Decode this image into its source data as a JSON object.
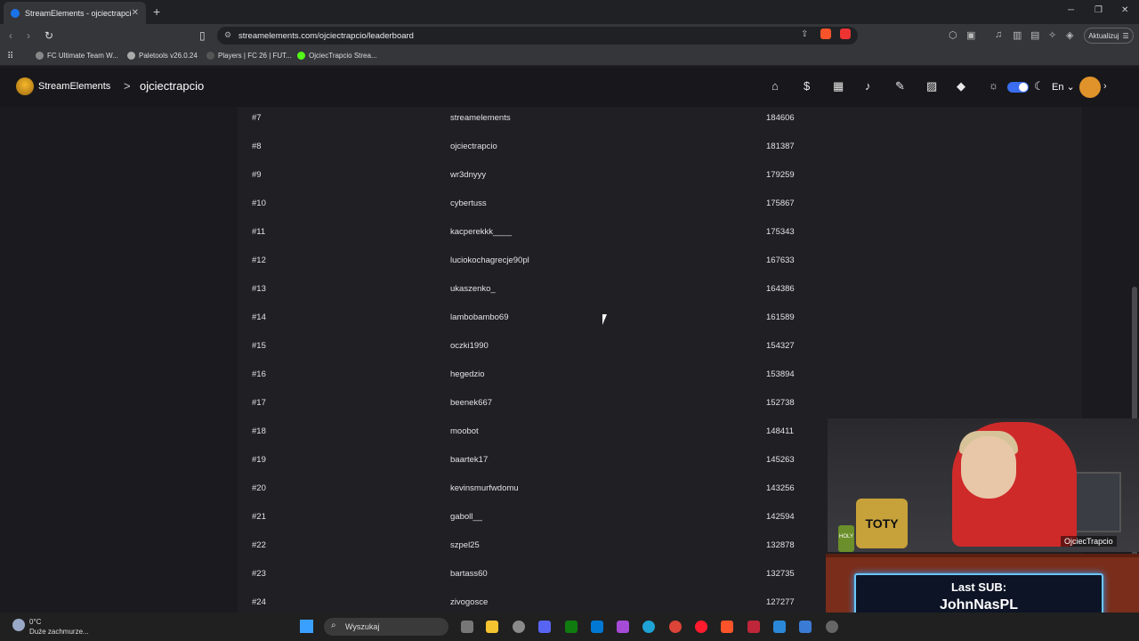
{
  "browser": {
    "tab_title": "StreamElements - ojciectrapcio",
    "url": "streamelements.com/ojciectrapcio/leaderboard",
    "update_label": "Aktualizuj",
    "bookmarks": [
      {
        "label": "FC Ultimate Team W...",
        "color": "#888888"
      },
      {
        "label": "Paletools v26.0.24",
        "color": "#aaaaaa"
      },
      {
        "label": "Players | FC 26 | FUT...",
        "color": "#555555"
      },
      {
        "label": "OjciecTrapcio Strea...",
        "color": "#53fc18"
      }
    ]
  },
  "header": {
    "brand": "StreamElements",
    "separator": ">",
    "channel": "ojciectrapcio",
    "language": "En",
    "nav_icons": [
      "home-icon",
      "dollar-icon",
      "store-icon",
      "music-icon",
      "tools-icon",
      "stats-icon",
      "gem-icon"
    ]
  },
  "leaderboard": {
    "rows": [
      {
        "rank": "#7",
        "name": "streamelements",
        "points": "184606"
      },
      {
        "rank": "#8",
        "name": "ojciectrapcio",
        "points": "181387"
      },
      {
        "rank": "#9",
        "name": "wr3dnyyy",
        "points": "179259"
      },
      {
        "rank": "#10",
        "name": "cybertuss",
        "points": "175867"
      },
      {
        "rank": "#11",
        "name": "kacperekkk____",
        "points": "175343"
      },
      {
        "rank": "#12",
        "name": "luciokochagrecje90pl",
        "points": "167633"
      },
      {
        "rank": "#13",
        "name": "ukaszenko_",
        "points": "164386"
      },
      {
        "rank": "#14",
        "name": "lambobambo69",
        "points": "161589"
      },
      {
        "rank": "#15",
        "name": "oczki1990",
        "points": "154327"
      },
      {
        "rank": "#16",
        "name": "hegedzio",
        "points": "153894"
      },
      {
        "rank": "#17",
        "name": "beenek667",
        "points": "152738"
      },
      {
        "rank": "#18",
        "name": "moobot",
        "points": "148411"
      },
      {
        "rank": "#19",
        "name": "baartek17",
        "points": "145263"
      },
      {
        "rank": "#20",
        "name": "kevinsmurfwdomu",
        "points": "143256"
      },
      {
        "rank": "#21",
        "name": "gaboll__",
        "points": "142594"
      },
      {
        "rank": "#22",
        "name": "szpel25",
        "points": "132878"
      },
      {
        "rank": "#23",
        "name": "bartass60",
        "points": "132735"
      },
      {
        "rank": "#24",
        "name": "zivogosce",
        "points": "127277"
      }
    ]
  },
  "overlay": {
    "badge": "TOTY",
    "can": "HOLY",
    "cam_name": "OjciecTrapcio",
    "last_sub_label": "Last SUB:",
    "last_sub_name": "JohnNasPL"
  },
  "taskbar": {
    "temperature": "0°C",
    "weather": "Duże zachmurze...",
    "search_placeholder": "Wyszukaj"
  },
  "colors": {
    "page_bg": "#1b1b1f",
    "board_bg": "#1f1f24",
    "accent": "#3b6df0",
    "sub_border": "#69c6ff"
  }
}
